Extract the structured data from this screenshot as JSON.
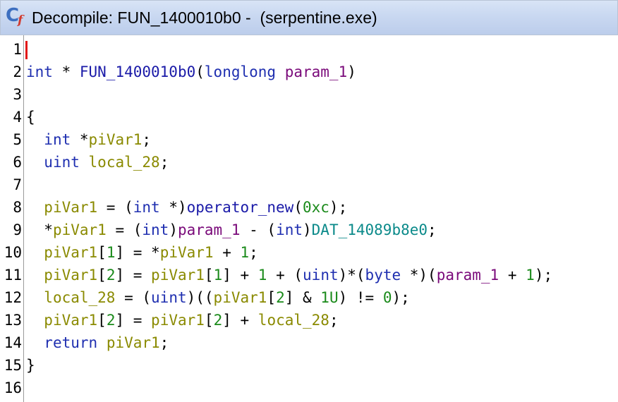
{
  "window": {
    "title": "Decompile: FUN_1400010b0 -  (serpentine.exe)",
    "icon": "decompiler-icon",
    "icon_letters": {
      "main": "C",
      "sub": "f"
    }
  },
  "colors": {
    "keyword": "#1f2fb0",
    "function": "#1a1aa8",
    "parameter": "#7a0a7a",
    "variable": "#8a8a00",
    "constant": "#1a8a1a",
    "global": "#0b8a8a",
    "caret": "#e21818",
    "titlebar": "#c9d8f1"
  },
  "code": {
    "lines": [
      {
        "n": "1",
        "tokens": []
      },
      {
        "n": "2",
        "tokens": [
          {
            "t": "int",
            "k": "kw"
          },
          {
            "t": " * ",
            "k": "op"
          },
          {
            "t": "FUN_1400010b0",
            "k": "fn"
          },
          {
            "t": "(",
            "k": "op"
          },
          {
            "t": "longlong",
            "k": "kw"
          },
          {
            "t": " ",
            "k": "op"
          },
          {
            "t": "param_1",
            "k": "param"
          },
          {
            "t": ")",
            "k": "op"
          }
        ]
      },
      {
        "n": "3",
        "tokens": []
      },
      {
        "n": "4",
        "tokens": [
          {
            "t": "{",
            "k": "op"
          }
        ]
      },
      {
        "n": "5",
        "tokens": [
          {
            "t": "  ",
            "k": "op"
          },
          {
            "t": "int",
            "k": "kw"
          },
          {
            "t": " *",
            "k": "op"
          },
          {
            "t": "piVar1",
            "k": "var"
          },
          {
            "t": ";",
            "k": "op"
          }
        ]
      },
      {
        "n": "6",
        "tokens": [
          {
            "t": "  ",
            "k": "op"
          },
          {
            "t": "uint",
            "k": "kw"
          },
          {
            "t": " ",
            "k": "op"
          },
          {
            "t": "local_28",
            "k": "var"
          },
          {
            "t": ";",
            "k": "op"
          }
        ]
      },
      {
        "n": "7",
        "tokens": []
      },
      {
        "n": "8",
        "tokens": [
          {
            "t": "  ",
            "k": "op"
          },
          {
            "t": "piVar1",
            "k": "var"
          },
          {
            "t": " = (",
            "k": "op"
          },
          {
            "t": "int",
            "k": "kw"
          },
          {
            "t": " *)",
            "k": "op"
          },
          {
            "t": "operator_new",
            "k": "fn"
          },
          {
            "t": "(",
            "k": "op"
          },
          {
            "t": "0xc",
            "k": "const"
          },
          {
            "t": ");",
            "k": "op"
          }
        ]
      },
      {
        "n": "9",
        "tokens": [
          {
            "t": "  *",
            "k": "op"
          },
          {
            "t": "piVar1",
            "k": "var"
          },
          {
            "t": " = (",
            "k": "op"
          },
          {
            "t": "int",
            "k": "kw"
          },
          {
            "t": ")",
            "k": "op"
          },
          {
            "t": "param_1",
            "k": "param"
          },
          {
            "t": " - (",
            "k": "op"
          },
          {
            "t": "int",
            "k": "kw"
          },
          {
            "t": ")",
            "k": "op"
          },
          {
            "t": "DAT_14089b8e0",
            "k": "glob"
          },
          {
            "t": ";",
            "k": "op"
          }
        ]
      },
      {
        "n": "10",
        "tokens": [
          {
            "t": "  ",
            "k": "op"
          },
          {
            "t": "piVar1",
            "k": "var"
          },
          {
            "t": "[",
            "k": "op"
          },
          {
            "t": "1",
            "k": "const"
          },
          {
            "t": "] = *",
            "k": "op"
          },
          {
            "t": "piVar1",
            "k": "var"
          },
          {
            "t": " + ",
            "k": "op"
          },
          {
            "t": "1",
            "k": "const"
          },
          {
            "t": ";",
            "k": "op"
          }
        ]
      },
      {
        "n": "11",
        "tokens": [
          {
            "t": "  ",
            "k": "op"
          },
          {
            "t": "piVar1",
            "k": "var"
          },
          {
            "t": "[",
            "k": "op"
          },
          {
            "t": "2",
            "k": "const"
          },
          {
            "t": "] = ",
            "k": "op"
          },
          {
            "t": "piVar1",
            "k": "var"
          },
          {
            "t": "[",
            "k": "op"
          },
          {
            "t": "1",
            "k": "const"
          },
          {
            "t": "] + ",
            "k": "op"
          },
          {
            "t": "1",
            "k": "const"
          },
          {
            "t": " + (",
            "k": "op"
          },
          {
            "t": "uint",
            "k": "kw"
          },
          {
            "t": ")*(",
            "k": "op"
          },
          {
            "t": "byte",
            "k": "kw"
          },
          {
            "t": " *)(",
            "k": "op"
          },
          {
            "t": "param_1",
            "k": "param"
          },
          {
            "t": " + ",
            "k": "op"
          },
          {
            "t": "1",
            "k": "const"
          },
          {
            "t": ");",
            "k": "op"
          }
        ]
      },
      {
        "n": "12",
        "tokens": [
          {
            "t": "  ",
            "k": "op"
          },
          {
            "t": "local_28",
            "k": "var"
          },
          {
            "t": " = (",
            "k": "op"
          },
          {
            "t": "uint",
            "k": "kw"
          },
          {
            "t": ")((",
            "k": "op"
          },
          {
            "t": "piVar1",
            "k": "var"
          },
          {
            "t": "[",
            "k": "op"
          },
          {
            "t": "2",
            "k": "const"
          },
          {
            "t": "] & ",
            "k": "op"
          },
          {
            "t": "1U",
            "k": "const"
          },
          {
            "t": ") != ",
            "k": "op"
          },
          {
            "t": "0",
            "k": "const"
          },
          {
            "t": ");",
            "k": "op"
          }
        ]
      },
      {
        "n": "13",
        "tokens": [
          {
            "t": "  ",
            "k": "op"
          },
          {
            "t": "piVar1",
            "k": "var"
          },
          {
            "t": "[",
            "k": "op"
          },
          {
            "t": "2",
            "k": "const"
          },
          {
            "t": "] = ",
            "k": "op"
          },
          {
            "t": "piVar1",
            "k": "var"
          },
          {
            "t": "[",
            "k": "op"
          },
          {
            "t": "2",
            "k": "const"
          },
          {
            "t": "] + ",
            "k": "op"
          },
          {
            "t": "local_28",
            "k": "var"
          },
          {
            "t": ";",
            "k": "op"
          }
        ]
      },
      {
        "n": "14",
        "tokens": [
          {
            "t": "  ",
            "k": "op"
          },
          {
            "t": "return",
            "k": "kw"
          },
          {
            "t": " ",
            "k": "op"
          },
          {
            "t": "piVar1",
            "k": "var"
          },
          {
            "t": ";",
            "k": "op"
          }
        ]
      },
      {
        "n": "15",
        "tokens": [
          {
            "t": "}",
            "k": "op"
          }
        ]
      },
      {
        "n": "16",
        "tokens": []
      }
    ]
  }
}
